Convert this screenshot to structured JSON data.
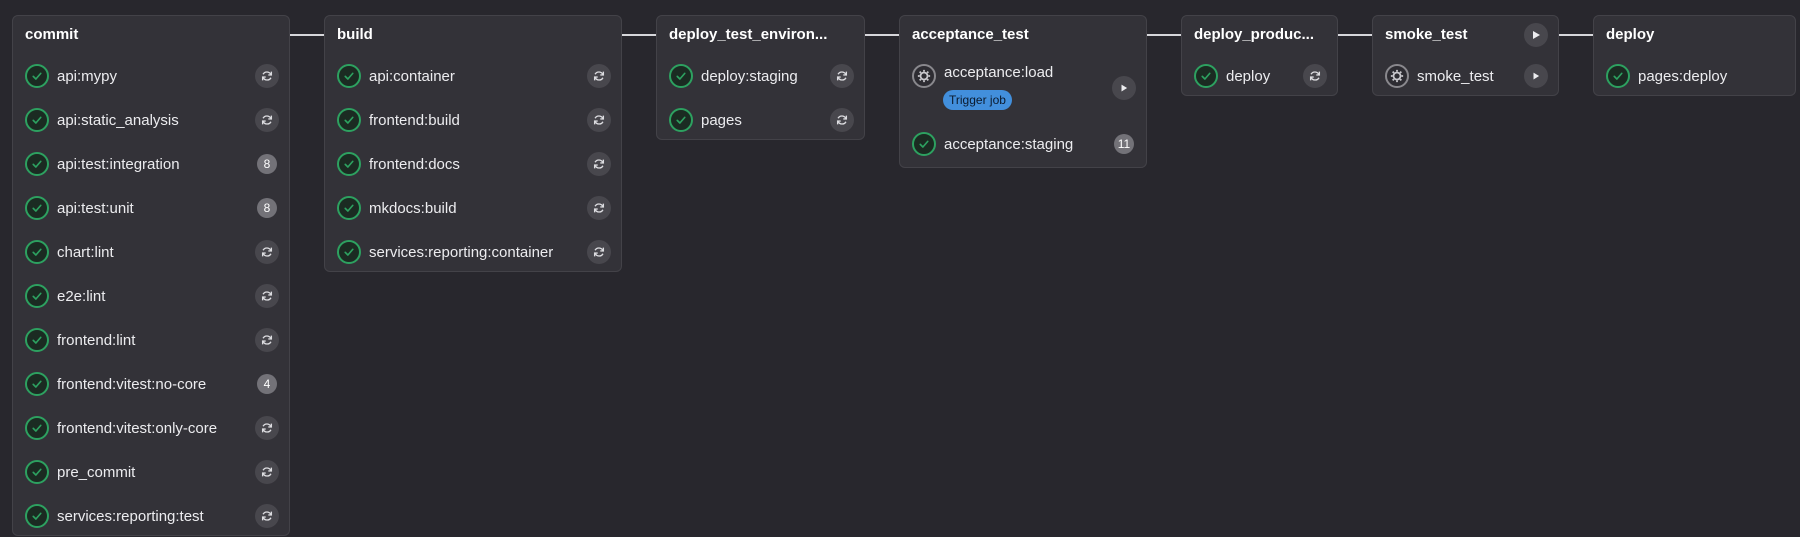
{
  "pipeline": {
    "stages": [
      {
        "title": "commit",
        "jobs": [
          {
            "name": "api:mypy",
            "status": "success",
            "action": "retry"
          },
          {
            "name": "api:static_analysis",
            "status": "success",
            "action": "retry"
          },
          {
            "name": "api:test:integration",
            "status": "success",
            "count": "8"
          },
          {
            "name": "api:test:unit",
            "status": "success",
            "count": "8"
          },
          {
            "name": "chart:lint",
            "status": "success",
            "action": "retry"
          },
          {
            "name": "e2e:lint",
            "status": "success",
            "action": "retry"
          },
          {
            "name": "frontend:lint",
            "status": "success",
            "action": "retry"
          },
          {
            "name": "frontend:vitest:no-core",
            "status": "success",
            "count": "4"
          },
          {
            "name": "frontend:vitest:only-core",
            "status": "success",
            "action": "retry"
          },
          {
            "name": "pre_commit",
            "status": "success",
            "action": "retry"
          },
          {
            "name": "services:reporting:test",
            "status": "success",
            "action": "retry"
          }
        ]
      },
      {
        "title": "build",
        "jobs": [
          {
            "name": "api:container",
            "status": "success",
            "action": "retry"
          },
          {
            "name": "frontend:build",
            "status": "success",
            "action": "retry"
          },
          {
            "name": "frontend:docs",
            "status": "success",
            "action": "retry"
          },
          {
            "name": "mkdocs:build",
            "status": "success",
            "action": "retry"
          },
          {
            "name": "services:reporting:container",
            "status": "success",
            "action": "retry"
          }
        ]
      },
      {
        "title": "deploy_test_environ...",
        "jobs": [
          {
            "name": "deploy:staging",
            "status": "success",
            "action": "retry"
          },
          {
            "name": "pages",
            "status": "success",
            "action": "retry"
          }
        ]
      },
      {
        "title": "acceptance_test",
        "jobs": [
          {
            "name": "acceptance:load",
            "status": "manual",
            "action": "play",
            "badge": "Trigger job"
          },
          {
            "name": "acceptance:staging",
            "status": "success",
            "count": "11"
          }
        ]
      },
      {
        "title": "deploy_produc...",
        "jobs": [
          {
            "name": "deploy",
            "status": "success",
            "action": "retry"
          }
        ]
      },
      {
        "title": "smoke_test",
        "stage_action": "play",
        "jobs": [
          {
            "name": "smoke_test",
            "status": "manual",
            "action": "play"
          }
        ]
      },
      {
        "title": "deploy",
        "jobs": [
          {
            "name": "pages:deploy",
            "status": "success"
          }
        ]
      }
    ]
  },
  "colors": {
    "background": "#28272d",
    "stage_bg": "#333238",
    "success": "#2da160",
    "manual": "#89888d",
    "badge": "#428fdc"
  },
  "icons": {
    "success": "check-circle-icon",
    "manual": "gear-icon",
    "retry": "retry-icon",
    "play": "play-icon"
  }
}
